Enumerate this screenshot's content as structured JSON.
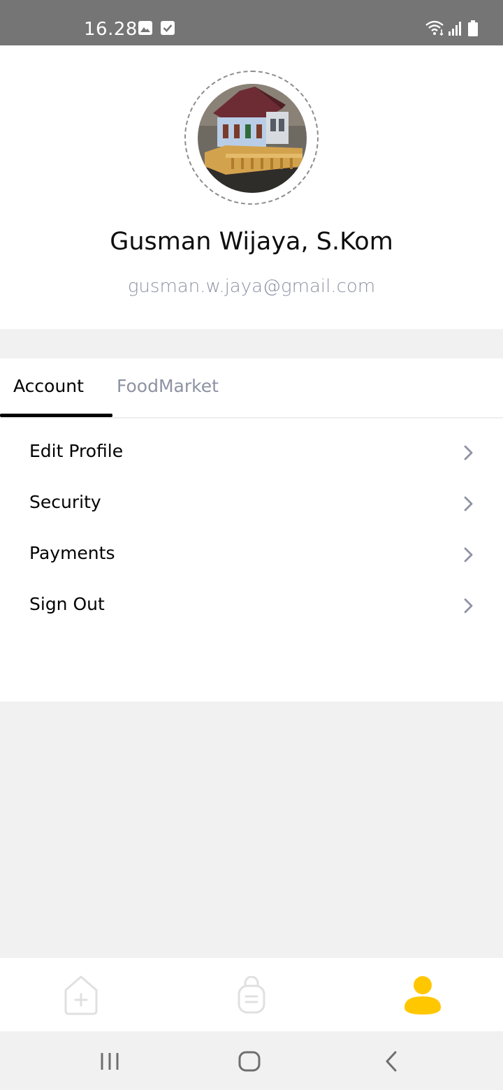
{
  "status_bar": {
    "time": "16.28",
    "left_icons": [
      "gallery-icon",
      "task-check-icon"
    ],
    "right_icons": [
      "wifi-icon",
      "signal-icon",
      "battery-icon"
    ]
  },
  "profile": {
    "avatar": "house-model-photo",
    "name": "Gusman Wijaya, S.Kom",
    "email": "gusman.w.jaya@gmail.com"
  },
  "tabs": [
    {
      "label": "Account",
      "active": true
    },
    {
      "label": "FoodMarket",
      "active": false
    }
  ],
  "menu": [
    {
      "label": "Edit Profile",
      "icon": "chevron-right-icon"
    },
    {
      "label": "Security",
      "icon": "chevron-right-icon"
    },
    {
      "label": "Payments",
      "icon": "chevron-right-icon"
    },
    {
      "label": "Sign Out",
      "icon": "chevron-right-icon"
    }
  ],
  "bottom_nav": [
    {
      "icon": "home-icon",
      "active": false
    },
    {
      "icon": "orders-bag-icon",
      "active": false
    },
    {
      "icon": "profile-icon",
      "active": true
    }
  ],
  "colors": {
    "accent": "#FFC700",
    "inactive_icon": "#E0E0E0",
    "muted_text": "#8D92A3",
    "status_bar": "#757575",
    "background": "#F1F1F1"
  },
  "system_nav": [
    "recent-apps-icon",
    "home-button-icon",
    "back-icon"
  ]
}
